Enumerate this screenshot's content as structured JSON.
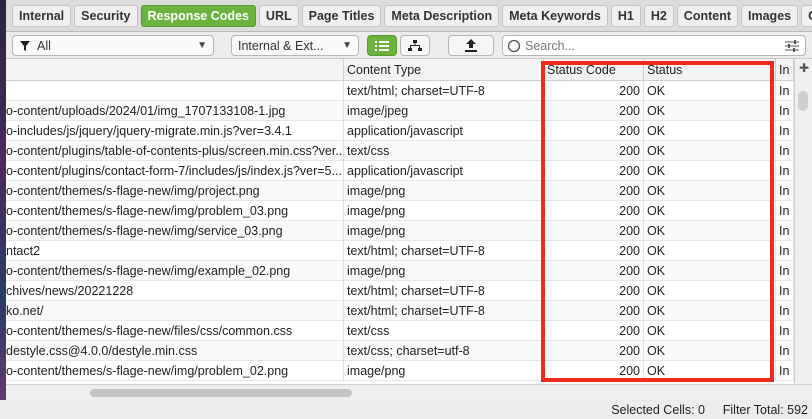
{
  "tabs": [
    {
      "label": "Internal",
      "active": false
    },
    {
      "label": "Security",
      "active": false
    },
    {
      "label": "Response Codes",
      "active": true
    },
    {
      "label": "URL",
      "active": false
    },
    {
      "label": "Page Titles",
      "active": false
    },
    {
      "label": "Meta Description",
      "active": false
    },
    {
      "label": "Meta Keywords",
      "active": false
    },
    {
      "label": "H1",
      "active": false
    },
    {
      "label": "H2",
      "active": false
    },
    {
      "label": "Content",
      "active": false
    },
    {
      "label": "Images",
      "active": false
    },
    {
      "label": "Ca",
      "active": false
    }
  ],
  "toolbar": {
    "filter_value": "All",
    "scope_value": "Internal & Ext...",
    "search_placeholder": "Search..."
  },
  "table": {
    "columns": [
      "",
      "Content Type",
      "Status Code",
      "Status",
      "In"
    ],
    "rows": [
      {
        "address": "",
        "type": "text/html; charset=UTF-8",
        "code": "200",
        "status": "OK",
        "idx": "In"
      },
      {
        "address": "o-content/uploads/2024/01/img_1707133108-1.jpg",
        "type": "image/jpeg",
        "code": "200",
        "status": "OK",
        "idx": "In"
      },
      {
        "address": "o-includes/js/jquery/jquery-migrate.min.js?ver=3.4.1",
        "type": "application/javascript",
        "code": "200",
        "status": "OK",
        "idx": "In"
      },
      {
        "address": "o-content/plugins/table-of-contents-plus/screen.min.css?ver...",
        "type": "text/css",
        "code": "200",
        "status": "OK",
        "idx": "In"
      },
      {
        "address": "o-content/plugins/contact-form-7/includes/js/index.js?ver=5....",
        "type": "application/javascript",
        "code": "200",
        "status": "OK",
        "idx": "In"
      },
      {
        "address": "o-content/themes/s-flage-new/img/project.png",
        "type": "image/png",
        "code": "200",
        "status": "OK",
        "idx": "In"
      },
      {
        "address": "o-content/themes/s-flage-new/img/problem_03.png",
        "type": "image/png",
        "code": "200",
        "status": "OK",
        "idx": "In"
      },
      {
        "address": "o-content/themes/s-flage-new/img/service_03.png",
        "type": "image/png",
        "code": "200",
        "status": "OK",
        "idx": "In"
      },
      {
        "address": "ntact2",
        "type": "text/html; charset=UTF-8",
        "code": "200",
        "status": "OK",
        "idx": "In"
      },
      {
        "address": "o-content/themes/s-flage-new/img/example_02.png",
        "type": "image/png",
        "code": "200",
        "status": "OK",
        "idx": "In"
      },
      {
        "address": "chives/news/20221228",
        "type": "text/html; charset=UTF-8",
        "code": "200",
        "status": "OK",
        "idx": "In"
      },
      {
        "address": "ko.net/",
        "type": "text/html; charset=UTF-8",
        "code": "200",
        "status": "OK",
        "idx": "In"
      },
      {
        "address": "o-content/themes/s-flage-new/files/css/common.css",
        "type": "text/css",
        "code": "200",
        "status": "OK",
        "idx": "In"
      },
      {
        "address": "destyle.css@4.0.0/destyle.min.css",
        "type": "text/css; charset=utf-8",
        "code": "200",
        "status": "OK",
        "idx": "In"
      },
      {
        "address": "o-content/themes/s-flage-new/img/problem_02.png",
        "type": "image/png",
        "code": "200",
        "status": "OK",
        "idx": "In"
      }
    ]
  },
  "statusbar": {
    "selected_cells": "Selected Cells:  0",
    "filter_total": "Filter Total:  592"
  },
  "colors": {
    "active_tab": "#6cb33e",
    "highlight_border": "#ef2b1f"
  }
}
